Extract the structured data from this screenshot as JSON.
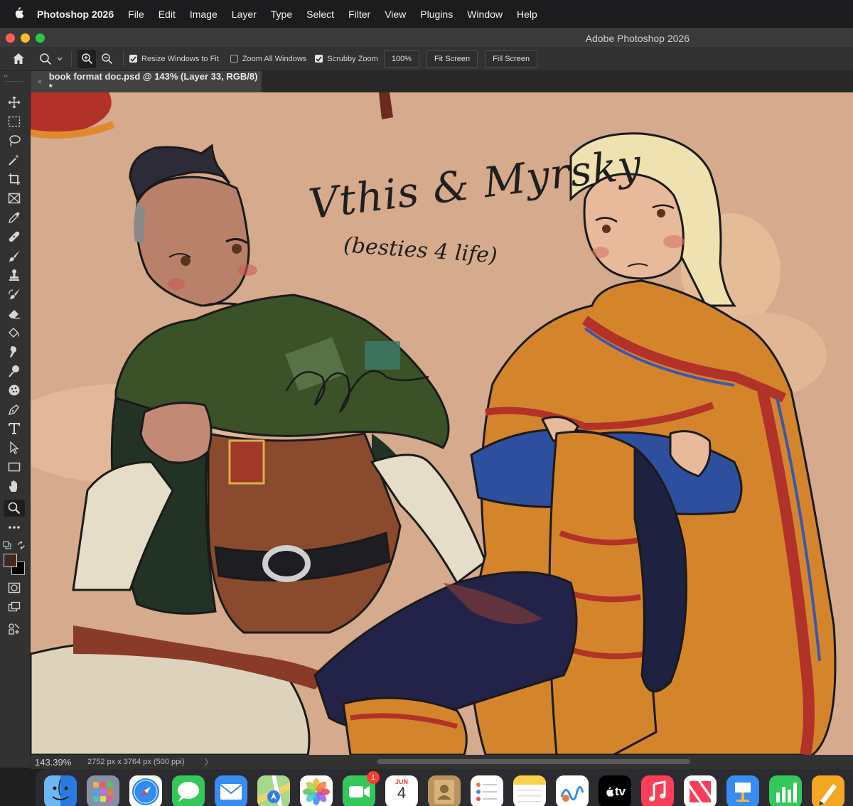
{
  "menubar": {
    "app_name": "Photoshop 2026",
    "items": [
      "File",
      "Edit",
      "Image",
      "Layer",
      "Type",
      "Select",
      "Filter",
      "View",
      "Plugins",
      "Window",
      "Help"
    ]
  },
  "window": {
    "title": "Adobe Photoshop 2026"
  },
  "options_bar": {
    "resize_windows_label": "Resize Windows to Fit",
    "resize_windows_checked": true,
    "zoom_all_label": "Zoom All Windows",
    "zoom_all_checked": false,
    "scrubby_zoom_label": "Scrubby Zoom",
    "scrubby_zoom_checked": true,
    "btn_100": "100%",
    "btn_fit": "Fit Screen",
    "btn_fill": "Fill Screen"
  },
  "document_tab": {
    "close": "×",
    "title": "book format doc.psd @ 143% (Layer 33, RGB/8) *"
  },
  "toolbar": {
    "collapse": "››",
    "tools": [
      "move-tool",
      "marquee-tool",
      "lasso-tool",
      "magic-wand-tool",
      "crop-tool",
      "frame-tool",
      "eyedropper-tool",
      "healing-brush-tool",
      "brush-tool",
      "clone-stamp-tool",
      "history-brush-tool",
      "eraser-tool",
      "paint-bucket-tool",
      "smudge-tool",
      "dodge-tool",
      "sponge-tool",
      "pen-tool",
      "type-tool",
      "path-selection-tool",
      "rectangle-tool",
      "hand-tool",
      "zoom-tool",
      "more-tools"
    ],
    "active_tool": "zoom-tool",
    "foreground_color": "#3d2a1c",
    "background_color": "#000000"
  },
  "canvas": {
    "handwriting_title": "Vthis & Myrsky",
    "handwriting_sub": "(besties 4 life)"
  },
  "status_bar": {
    "zoom": "143.39%",
    "doc_info": "2752 px x 3764 px (500 ppi)",
    "arrow": "〉"
  },
  "dock": {
    "apps": [
      "Finder",
      "Launchpad",
      "Safari",
      "Messages",
      "Mail",
      "Maps",
      "Photos",
      "FaceTime",
      "Calendar",
      "Contacts",
      "Reminders",
      "Notes",
      "Freeform",
      "TV",
      "Music",
      "News",
      "Keynote",
      "Numbers",
      "Pages"
    ],
    "facetime_badge": "1",
    "calendar_month": "JUN",
    "calendar_day": "4",
    "tv_label": "tv"
  }
}
